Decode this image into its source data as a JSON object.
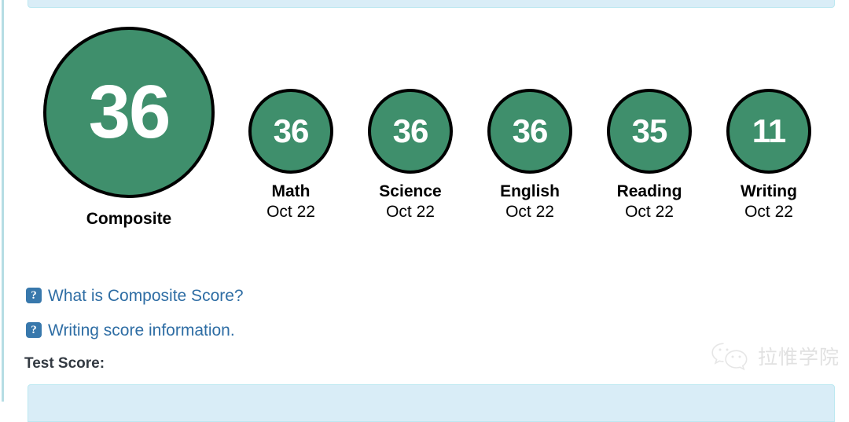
{
  "colors": {
    "bubble_green": "#3f8f6c",
    "bubble_border": "#000000",
    "bubble_text": "#ffffff",
    "link_blue": "#2e6da4",
    "icon_blue": "#3878ac",
    "band_blue": "#d9edf7",
    "band_border": "#bce8f1",
    "left_rule": "#b6dde4",
    "label_dark": "#333a42",
    "watermark_gray": "#bdbdbd"
  },
  "composite": {
    "score": "36",
    "label": "Composite"
  },
  "subjects": [
    {
      "score": "36",
      "label": "Math",
      "date": "Oct 22"
    },
    {
      "score": "36",
      "label": "Science",
      "date": "Oct 22"
    },
    {
      "score": "36",
      "label": "English",
      "date": "Oct 22"
    },
    {
      "score": "35",
      "label": "Reading",
      "date": "Oct 22"
    },
    {
      "score": "11",
      "label": "Writing",
      "date": "Oct 22"
    }
  ],
  "help_links": [
    {
      "icon": "question-mark-icon",
      "glyph": "?",
      "text": "What is Composite Score?"
    },
    {
      "icon": "question-mark-icon",
      "glyph": "?",
      "text": "Writing score information."
    }
  ],
  "test_score": {
    "label": "Test Score:"
  },
  "watermark": {
    "icon": "wechat-icon",
    "text": "拉惟学院"
  }
}
